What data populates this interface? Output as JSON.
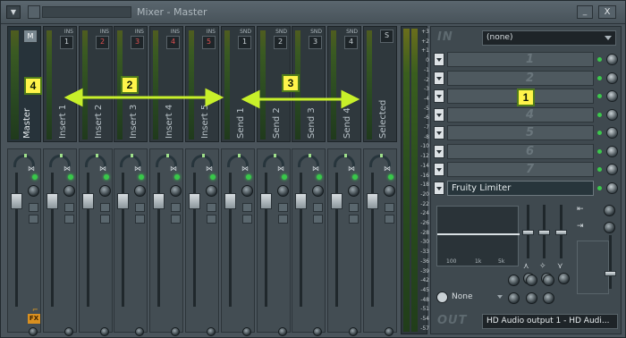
{
  "window": {
    "title": "Mixer - Master",
    "minimize_glyph": "_",
    "close_glyph": "X"
  },
  "strips": [
    {
      "label": "Master",
      "badge": "",
      "tag": "",
      "flag": "M"
    },
    {
      "label": "Insert 1",
      "badge": "1",
      "tag": "INS"
    },
    {
      "label": "Insert 2",
      "badge": "2",
      "tag": "INS"
    },
    {
      "label": "Insert 3",
      "badge": "3",
      "tag": "INS"
    },
    {
      "label": "Insert 4",
      "badge": "4",
      "tag": "INS"
    },
    {
      "label": "Insert 5",
      "badge": "5",
      "tag": "INS"
    },
    {
      "label": "Send 1",
      "badge": "1",
      "tag": "SND"
    },
    {
      "label": "Send 2",
      "badge": "2",
      "tag": "SND"
    },
    {
      "label": "Send 3",
      "badge": "3",
      "tag": "SND"
    },
    {
      "label": "Send 4",
      "badge": "4",
      "tag": "SND"
    },
    {
      "label": "Selected",
      "badge": "S",
      "tag": ""
    }
  ],
  "fx_badge": "FX",
  "meter_scale": [
    "+3",
    "+2",
    "+1",
    "0",
    "-1",
    "-2",
    "-3",
    "-4",
    "-5",
    "-6",
    "-7",
    "-8",
    "-10",
    "-12",
    "-14",
    "-16",
    "-18",
    "-20",
    "-22",
    "-24",
    "-26",
    "-28",
    "-30",
    "-33",
    "-36",
    "-39",
    "-42",
    "-45",
    "-48",
    "-51",
    "-54",
    "-57"
  ],
  "effects_panel": {
    "in_label": "IN",
    "in_select": "(none)",
    "slots": [
      {
        "label": "1",
        "active": false
      },
      {
        "label": "2",
        "active": false
      },
      {
        "label": "3",
        "active": false
      },
      {
        "label": "4",
        "active": false
      },
      {
        "label": "5",
        "active": false
      },
      {
        "label": "6",
        "active": false
      },
      {
        "label": "7",
        "active": false
      },
      {
        "label": "Fruity Limiter",
        "active": true
      }
    ],
    "eq_freqs": [
      "100",
      "1k",
      "5k"
    ],
    "none_select": "None",
    "out_label": "OUT",
    "out_select": "HD Audio output 1 - HD Audi..."
  },
  "annotations": [
    {
      "label": "1"
    },
    {
      "label": "2"
    },
    {
      "label": "3"
    },
    {
      "label": "4"
    }
  ],
  "colors": {
    "accent_callout": "#fff44a",
    "arrow": "#c8f02a",
    "led": "#39c84a",
    "fx_orange": "#d99020"
  }
}
